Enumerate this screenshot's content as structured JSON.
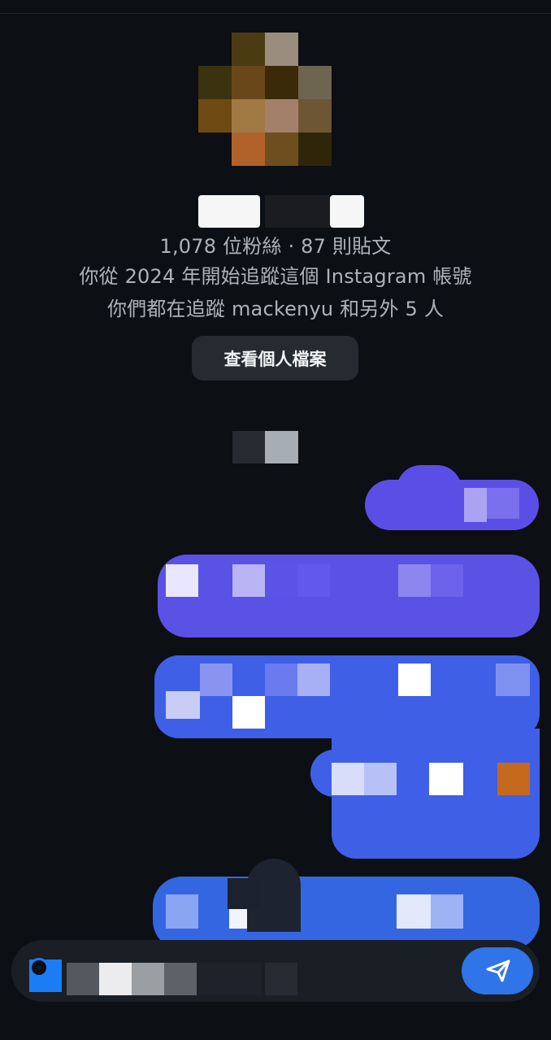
{
  "profile": {
    "stats": "1,078 位粉絲 · 87 則貼文",
    "following_since": "你從 2024 年開始追蹤這個 Instagram 帳號",
    "mutual_follow": "你們都在追蹤 mackenyu 和另外 5 人",
    "view_profile_label": "查看個人檔案"
  },
  "composer": {
    "placeholder": "",
    "send_icon": "paper-plane-icon"
  },
  "colors": {
    "background": "#0c0f14",
    "bubble_purple": "#5b4ee6",
    "bubble_blue": "#3d63e6",
    "send_button": "#2f74e8",
    "button_bg": "#262a31"
  }
}
